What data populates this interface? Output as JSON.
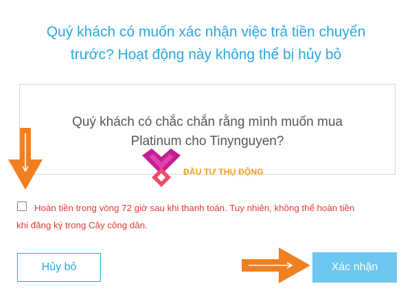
{
  "dialog": {
    "title_line1": "Quý khách có muốn xác nhận việc trả tiền chuyển",
    "title_line2": "trước? Hoạt động này không thể bị hủy bỏ",
    "message_line1": "Quý khách có chắc chắn rằng mình muốn mua",
    "message_line2": "Platinum cho Tinynguyen?",
    "refund_line1": "Hoàn tiền trong vòng 72 giờ sau khi thanh toán. Tuy nhiên, không thể hoàn tiền",
    "refund_line2": "khi đăng ký trong Cây công dân.",
    "refund_checked": false,
    "cancel_label": "Hủy bỏ",
    "confirm_label": "Xác nhận"
  },
  "watermark": {
    "text": "ĐẦU TƯ THỤ ĐỘNG"
  },
  "colors": {
    "title": "#2aa7dc",
    "refund_text": "#e53935",
    "confirm_bg": "#6cc6ef",
    "arrow": "#f07f1f"
  },
  "icons": [
    "down-arrow-icon",
    "right-arrow-icon",
    "watermark-logo-icon",
    "checkbox"
  ]
}
